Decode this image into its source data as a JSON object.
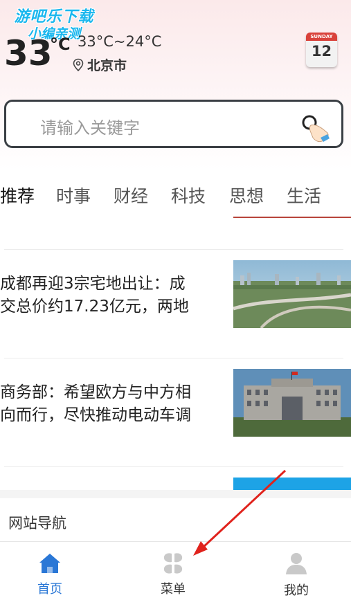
{
  "watermark": {
    "line1": "游吧乐下载",
    "line2": "小编亲测"
  },
  "weather": {
    "temp": "33",
    "unit": "°C",
    "range": "33°C~24°C",
    "city": "北京市"
  },
  "calendar": {
    "weekday": "SUNDAY",
    "day": "12"
  },
  "search": {
    "placeholder": "请输入关键字"
  },
  "tabs": [
    "推荐",
    "时事",
    "财经",
    "科技",
    "思想",
    "生活"
  ],
  "news": [
    {
      "line1": "成都再迎3宗宅地出让：成",
      "line2": "交总价约17.23亿元，两地"
    },
    {
      "line1": "商务部：希望欧方与中方相",
      "line2": "向而行，尽快推动电动车调"
    }
  ],
  "nav_title": "网站导航",
  "bottom_nav": [
    {
      "label": "首页",
      "icon": "home-icon",
      "active": true
    },
    {
      "label": "菜单",
      "icon": "menu-grid-icon",
      "active": false
    },
    {
      "label": "我的",
      "icon": "user-icon",
      "active": false
    }
  ],
  "colors": {
    "accent_blue": "#2a77d6",
    "tab_underline": "#b8453b",
    "arrow": "#e0221c"
  }
}
